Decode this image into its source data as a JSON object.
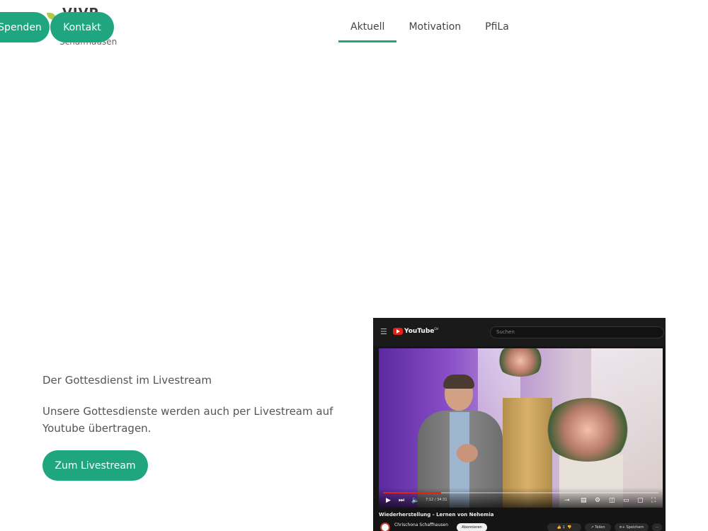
{
  "header": {
    "logo_text": "VIVP",
    "logo_subtitle": "Schaffhausen",
    "spenden_label": "Spenden",
    "kontakt_label": "Kontakt",
    "nav": [
      {
        "label": "Aktuell",
        "active": true
      },
      {
        "label": "Motivation",
        "active": false
      },
      {
        "label": "PfiLa",
        "active": false
      }
    ]
  },
  "livestream": {
    "title": "Der Gottesdienst im Livestream",
    "text": "Unsere Gottesdienste werden auch per Livestream auf Youtube übertragen.",
    "button_label": "Zum Livestream"
  },
  "video": {
    "platform_label": "YouTube",
    "region": "CH",
    "search_placeholder": "Suchen",
    "time": "7:12 / 34:31",
    "progress_fraction": 0.21,
    "title": "Wiederherstellung - Lernen von Nehemia",
    "channel": "Chrischona Schaffhausen",
    "subscribe_label": "Abonnieren",
    "likes": "1",
    "share_label": "Teilen",
    "save_label": "Speichern",
    "more_label": "···"
  },
  "colors": {
    "accent": "#1fa57f",
    "youtube_red": "#e62117"
  }
}
